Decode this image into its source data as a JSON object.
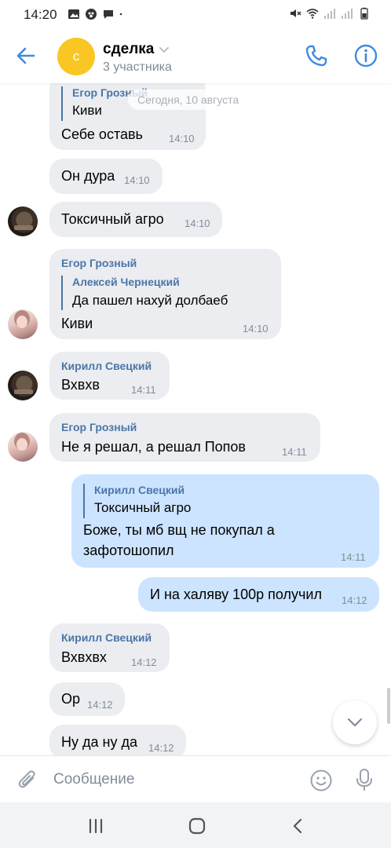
{
  "status_bar": {
    "time": "14:20"
  },
  "header": {
    "avatar_letter": "с",
    "title": "сделка",
    "subtitle": "3 участника",
    "avatar_color": "#f9c623"
  },
  "date_divider": "Сегодня, 10 августа",
  "messages": [
    {
      "author": "",
      "quote_author": "Егор Грозный",
      "quote_text": "Киви",
      "text": "Себе оставь",
      "time": "14:10"
    },
    {
      "author": "",
      "text": "Он дура",
      "time": "14:10"
    },
    {
      "author": "",
      "text": "Токсичный агро",
      "time": "14:10"
    },
    {
      "author": "Егор Грозный",
      "quote_author": "Алексей Чернецкий",
      "quote_text": "Да пашел нахуй долбаеб",
      "text": "Киви",
      "time": "14:10"
    },
    {
      "author": "Кирилл Свецкий",
      "text": "Вхвхв",
      "time": "14:11"
    },
    {
      "author": "Егор Грозный",
      "text": "Не я решал, а решал Попов",
      "time": "14:11"
    },
    {
      "quote_author": "Кирилл Свецкий",
      "quote_text": "Токсичный агро",
      "text_line1": "Боже, ты мб вщ не покупал а",
      "text_line2": "зафотошопил",
      "time": "14:11"
    },
    {
      "text": "И на халяву 100р получил",
      "time": "14:12"
    },
    {
      "author": "Кирилл Свецкий",
      "text": "Вхвхвх",
      "time": "14:12"
    },
    {
      "text": "Ор",
      "time": "14:12"
    },
    {
      "text": "Ну да ну да",
      "time": "14:12"
    }
  ],
  "composer": {
    "placeholder": "Сообщение"
  },
  "colors": {
    "incoming_bubble": "#ebedf0",
    "outgoing_bubble": "#cce4ff",
    "accent": "#4a76a8",
    "icon_blue": "#3f8ae0"
  },
  "icons": [
    "back-arrow-icon",
    "chevron-down-icon",
    "phone-icon",
    "info-icon",
    "paperclip-icon",
    "smile-icon",
    "microphone-icon",
    "chevron-down-icon",
    "recents-icon",
    "home-icon",
    "back-icon"
  ]
}
